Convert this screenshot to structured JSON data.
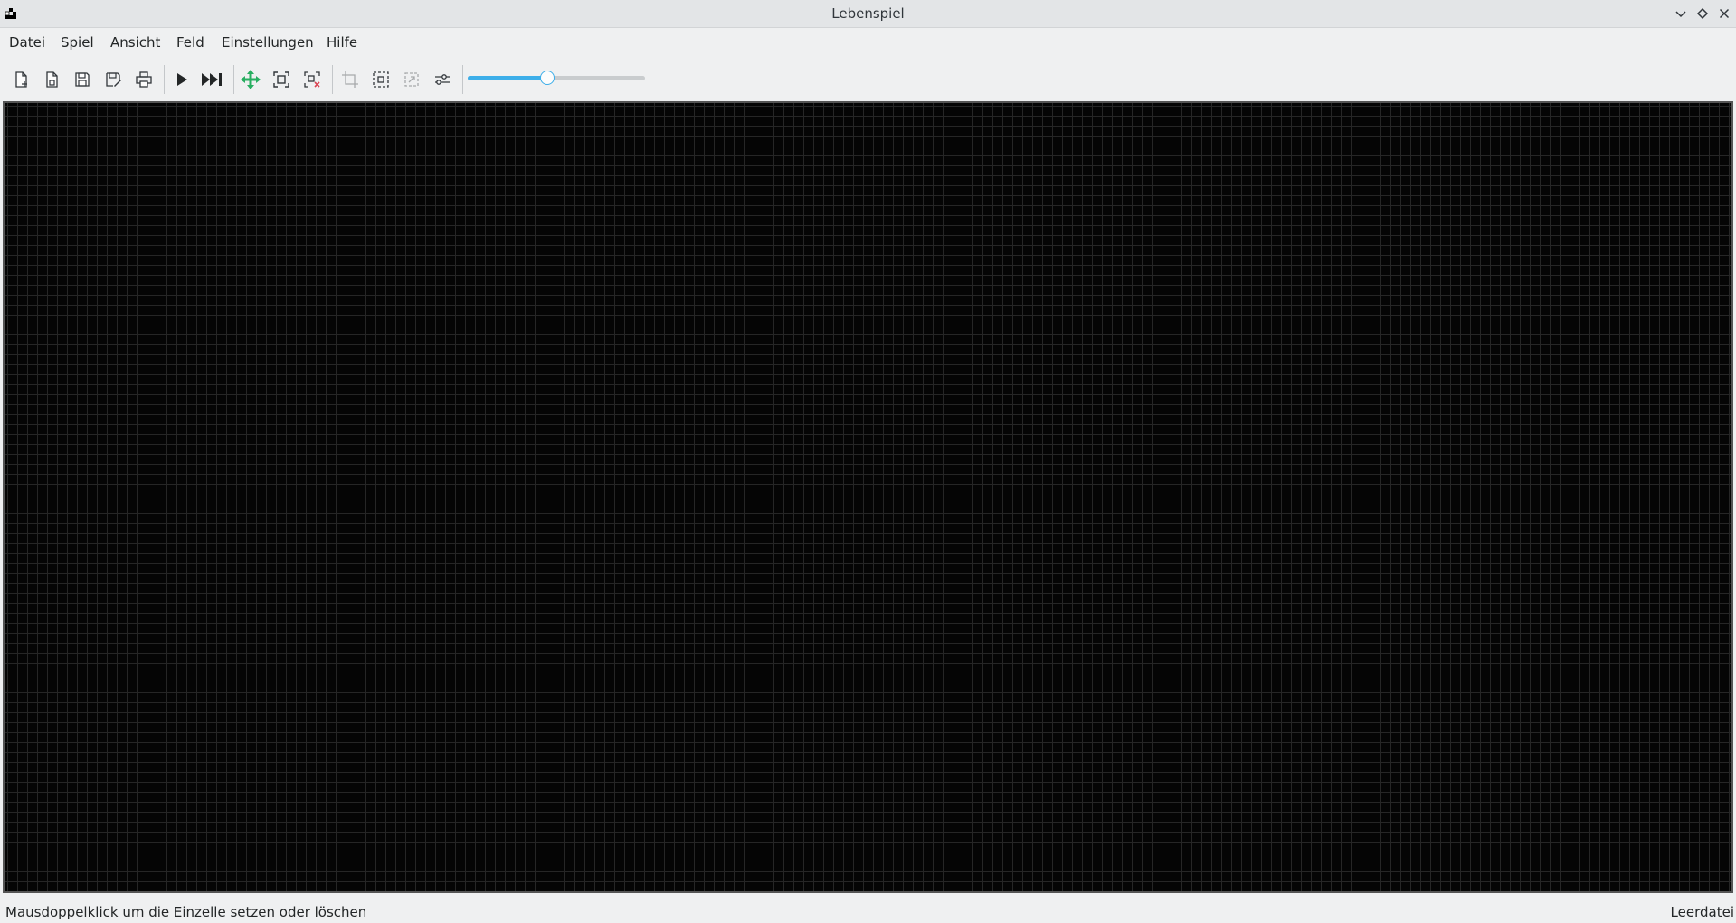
{
  "window": {
    "title": "Lebenspiel",
    "icon": "app-glider-icon"
  },
  "menubar": {
    "items": [
      {
        "label": "Datei"
      },
      {
        "label": "Spiel"
      },
      {
        "label": "Ansicht"
      },
      {
        "label": "Feld"
      },
      {
        "label": "Einstellungen"
      },
      {
        "label": "Hilfe"
      }
    ]
  },
  "toolbar": {
    "buttons": [
      {
        "icon": "new-document-icon"
      },
      {
        "icon": "open-document-icon"
      },
      {
        "icon": "save-icon"
      },
      {
        "icon": "save-as-icon"
      },
      {
        "icon": "print-icon"
      },
      {
        "icon": "play-icon"
      },
      {
        "icon": "step-forward-icon"
      },
      {
        "icon": "move-icon"
      },
      {
        "icon": "zoom-fit-icon"
      },
      {
        "icon": "clear-selection-icon"
      },
      {
        "icon": "crop-icon"
      },
      {
        "icon": "select-region-icon"
      },
      {
        "icon": "paste-icon"
      },
      {
        "icon": "settings-sliders-icon"
      }
    ],
    "speed_slider": {
      "value_fraction": 0.45
    }
  },
  "field": {
    "background": "#050505",
    "grid_color": "#262626"
  },
  "statusbar": {
    "hint": "Mausdoppelklick um die Einzelle setzen oder löschen",
    "file_state": "Leerdatei"
  },
  "colors": {
    "accent": "#3daee9",
    "move_icon": "#27ae60",
    "clear_mark": "#da4453"
  }
}
